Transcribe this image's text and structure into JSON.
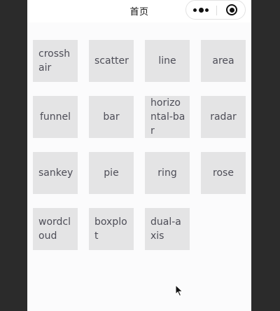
{
  "navbar": {
    "title": "首页",
    "more_icon": "more-dots-icon",
    "close_icon": "target-circle-icon"
  },
  "charts": [
    {
      "label": "crosshair",
      "wrapped": true
    },
    {
      "label": "scatter",
      "wrapped": true
    },
    {
      "label": "line",
      "wrapped": false
    },
    {
      "label": "area",
      "wrapped": false
    },
    {
      "label": "funnel",
      "wrapped": false
    },
    {
      "label": "bar",
      "wrapped": false
    },
    {
      "label": "horizontal-bar",
      "wrapped": true
    },
    {
      "label": "radar",
      "wrapped": false
    },
    {
      "label": "sankey",
      "wrapped": true
    },
    {
      "label": "pie",
      "wrapped": false
    },
    {
      "label": "ring",
      "wrapped": false
    },
    {
      "label": "rose",
      "wrapped": false
    },
    {
      "label": "wordcloud",
      "wrapped": true
    },
    {
      "label": "boxplot",
      "wrapped": true
    },
    {
      "label": "dual-axis",
      "wrapped": true
    }
  ],
  "colors": {
    "tile_bg": "#e4e4e5",
    "tile_text": "#4d4d57",
    "page_bg": "#fbfbfc",
    "outer_bg": "#2b2b2b"
  }
}
